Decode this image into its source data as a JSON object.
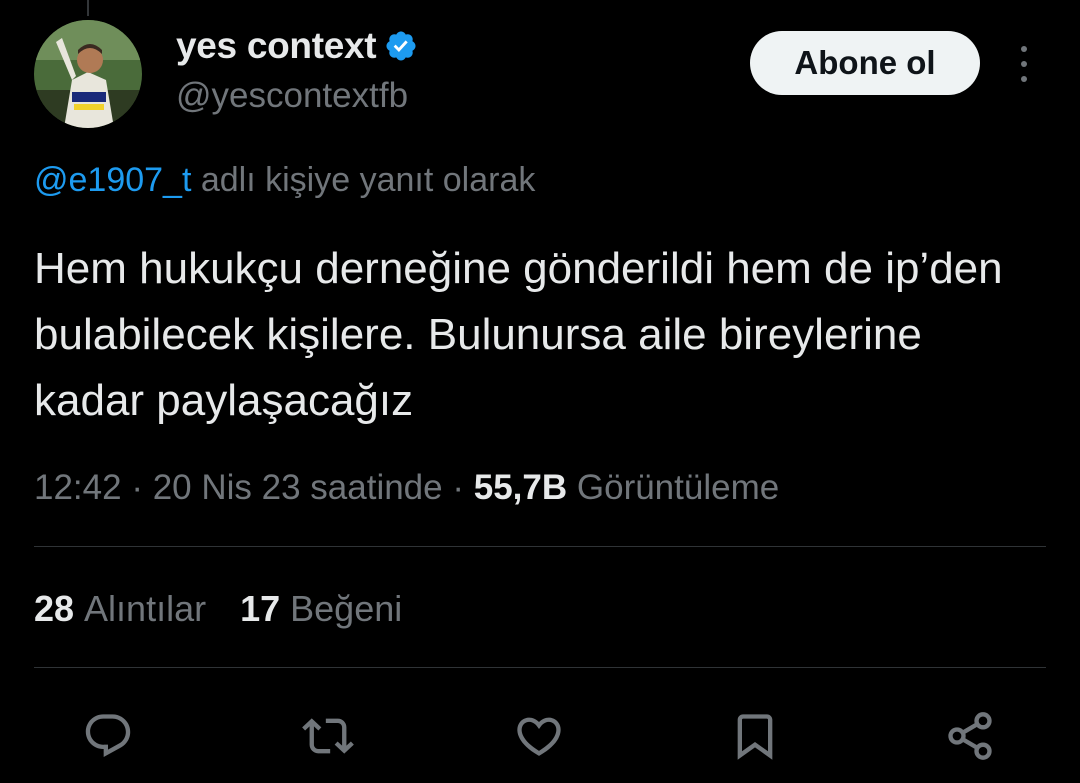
{
  "tweet": {
    "author": {
      "display_name": "yes context",
      "handle": "@yescontextfb",
      "verified": true
    },
    "follow_label": "Abone ol",
    "reply_to": {
      "handle": "@e1907_t",
      "suffix": " adlı kişiye yanıt olarak"
    },
    "text": "Hem hukukçu derneğine gönderildi hem de ip’den bulabilecek kişilere. Bulunursa aile bireylerine kadar paylaşacağız",
    "meta": {
      "time": "12:42",
      "date": "20 Nis 23 saatinde",
      "views_count": "55,7B",
      "views_label": "Görüntüleme"
    },
    "stats": {
      "quotes_count": "28",
      "quotes_label": "Alıntılar",
      "likes_count": "17",
      "likes_label": "Beğeni"
    }
  },
  "colors": {
    "background": "#000000",
    "text_primary": "#e7e9ea",
    "text_secondary": "#71767b",
    "link": "#1d9bf0",
    "divider": "#2f3336"
  },
  "icons": {
    "verified": "verified-badge-icon",
    "more": "more-vertical-icon",
    "actions": [
      "reply-icon",
      "retweet-icon",
      "like-icon",
      "bookmark-icon",
      "share-icon"
    ]
  }
}
